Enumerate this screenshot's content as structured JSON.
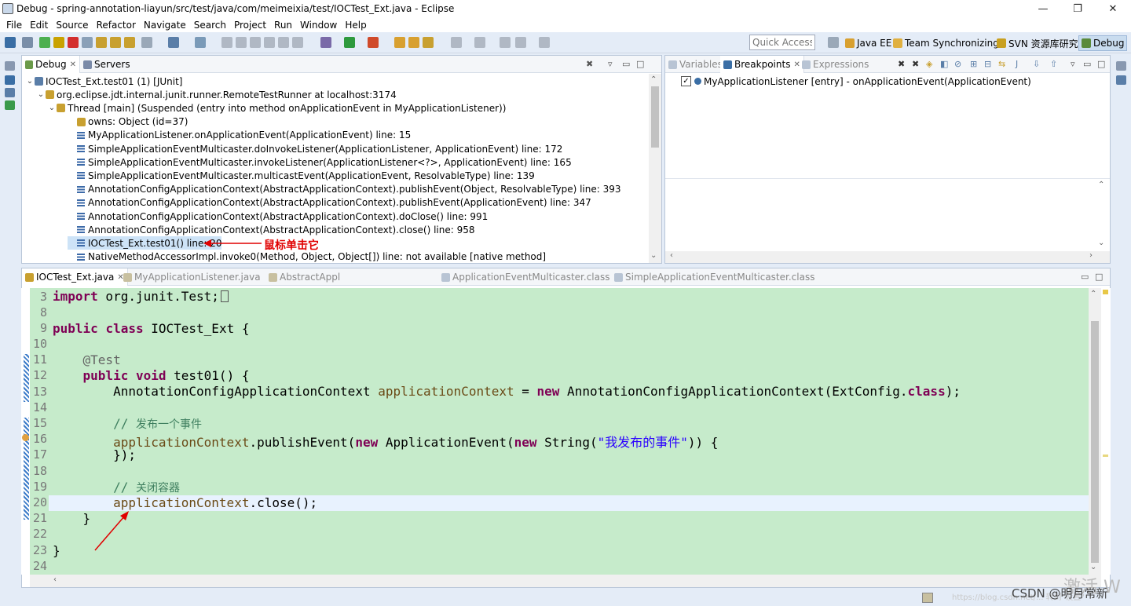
{
  "window": {
    "title": "Debug - spring-annotation-liayun/src/test/java/com/meimeixia/test/IOCTest_Ext.java - Eclipse",
    "minimize": "—",
    "maximize": "❐",
    "close": "✕"
  },
  "menu": [
    "File",
    "Edit",
    "Source",
    "Refactor",
    "Navigate",
    "Search",
    "Project",
    "Run",
    "Window",
    "Help"
  ],
  "toolbar": {
    "quick_access_placeholder": "Quick Access",
    "perspectives": [
      {
        "label": "Java EE",
        "icon": "java-ee-icon",
        "color": "#d8a030"
      },
      {
        "label": "Team Synchronizing",
        "icon": "team-sync-icon",
        "color": "#e0b040"
      },
      {
        "label": "SVN 资源库研究",
        "icon": "svn-icon",
        "color": "#c8a020"
      },
      {
        "label": "Debug",
        "icon": "debug-perspective-icon",
        "color": "#5a8a3a",
        "active": true
      }
    ]
  },
  "debug_view": {
    "tabs": [
      {
        "label": "Debug",
        "active": true,
        "icon": "debug-tab-icon"
      },
      {
        "label": "Servers",
        "active": false,
        "icon": "servers-icon"
      }
    ],
    "tree": [
      {
        "text": "IOCTest_Ext.test01 (1) [JUnit]",
        "indent": 0,
        "twisty": "⌄",
        "icon": "junit-icon"
      },
      {
        "text": "org.eclipse.jdt.internal.junit.runner.RemoteTestRunner at localhost:3174",
        "indent": 1,
        "twisty": "⌄",
        "icon": "process-icon"
      },
      {
        "text": "Thread [main] (Suspended (entry into method onApplicationEvent in MyApplicationListener))",
        "indent": 2,
        "twisty": "⌄",
        "icon": "thread-icon"
      },
      {
        "text": "owns: Object  (id=37)",
        "indent": 3,
        "twisty": "",
        "icon": "owns-icon"
      },
      {
        "text": "MyApplicationListener.onApplicationEvent(ApplicationEvent) line: 15",
        "indent": 3,
        "twisty": "",
        "icon": "stack-frame-icon"
      },
      {
        "text": "SimpleApplicationEventMulticaster.doInvokeListener(ApplicationListener, ApplicationEvent) line: 172",
        "indent": 3,
        "twisty": "",
        "icon": "stack-frame-icon"
      },
      {
        "text": "SimpleApplicationEventMulticaster.invokeListener(ApplicationListener<?>, ApplicationEvent) line: 165",
        "indent": 3,
        "twisty": "",
        "icon": "stack-frame-icon"
      },
      {
        "text": "SimpleApplicationEventMulticaster.multicastEvent(ApplicationEvent, ResolvableType) line: 139",
        "indent": 3,
        "twisty": "",
        "icon": "stack-frame-icon"
      },
      {
        "text": "AnnotationConfigApplicationContext(AbstractApplicationContext).publishEvent(Object, ResolvableType) line: 393",
        "indent": 3,
        "twisty": "",
        "icon": "stack-frame-icon"
      },
      {
        "text": "AnnotationConfigApplicationContext(AbstractApplicationContext).publishEvent(ApplicationEvent) line: 347",
        "indent": 3,
        "twisty": "",
        "icon": "stack-frame-icon"
      },
      {
        "text": "AnnotationConfigApplicationContext(AbstractApplicationContext).doClose() line: 991",
        "indent": 3,
        "twisty": "",
        "icon": "stack-frame-icon"
      },
      {
        "text": "AnnotationConfigApplicationContext(AbstractApplicationContext).close() line: 958",
        "indent": 3,
        "twisty": "",
        "icon": "stack-frame-icon"
      },
      {
        "text": "IOCTest_Ext.test01() line: 20",
        "indent": 3,
        "twisty": "",
        "icon": "stack-frame-icon",
        "selected": true
      },
      {
        "text": "NativeMethodAccessorImpl.invoke0(Method, Object, Object[]) line: not available [native method]",
        "indent": 3,
        "twisty": "",
        "icon": "stack-frame-icon"
      }
    ],
    "annotation": "鼠标单击它"
  },
  "breakpoints_view": {
    "tabs": [
      {
        "label": "Variables",
        "active": false
      },
      {
        "label": "Breakpoints",
        "active": true
      },
      {
        "label": "Expressions",
        "active": false
      }
    ],
    "items": [
      {
        "text": "MyApplicationListener [entry] - onApplicationEvent(ApplicationEvent)",
        "checked": true
      }
    ]
  },
  "editor": {
    "tabs": [
      {
        "label": "IOCTest_Ext.java",
        "active": true
      },
      {
        "label": "MyApplicationListener.java",
        "active": false
      },
      {
        "label": "AbstractAppl",
        "active": false
      },
      {
        "label": "ApplicationEventMulticaster.class",
        "active": false
      },
      {
        "label": "SimpleApplicationEventMulticaster.class",
        "active": false
      }
    ],
    "line_numbers": [
      "3",
      "8",
      "9",
      "10",
      "11",
      "12",
      "13",
      "14",
      "15",
      "16",
      "17",
      "18",
      "19",
      "20",
      "21",
      "22",
      "23",
      "24"
    ],
    "code": {
      "l3_kw": "import",
      "l3_rest": " org.junit.Test;",
      "l9_kw1": "public",
      "l9_kw2": "class",
      "l9_rest": " IOCTest_Ext {",
      "l11_ann": "@Test",
      "l12_kw1": "public",
      "l12_kw2": "void",
      "l12_rest": " test01() {",
      "l13_type": "AnnotationConfigApplicationContext ",
      "l13_var": "applicationContext",
      "l13_eq": " = ",
      "l13_new": "new",
      "l13_rest1": " AnnotationConfigApplicationContext(ExtConfig.",
      "l13_cls": "class",
      "l13_rest2": ");",
      "l15_slash": "// ",
      "l15_cmt": "发布一个事件",
      "l16_var": "applicationContext",
      "l16_a": ".publishEvent(",
      "l16_new1": "new",
      "l16_b": " ApplicationEvent(",
      "l16_new2": "new",
      "l16_c": " String(",
      "l16_str": "\"我发布的事件\"",
      "l16_d": ")) {",
      "l17": "});",
      "l19_slash": "// ",
      "l19_cmt": "关闭容器",
      "l20_var": "applicationContext",
      "l20_rest": ".close();",
      "l21": "}",
      "l23": "}"
    }
  },
  "watermark": {
    "csdn": "CSDN @明月常新",
    "big": "激活 W",
    "small": "https://blog.csdn.net/...  转到\"设置\""
  },
  "colors": {
    "code_bg": "#c6ebcb",
    "keyword": "#7f0055",
    "string": "#2a00ff",
    "comment": "#3f7f5f",
    "annotation_red": "#e00000"
  }
}
